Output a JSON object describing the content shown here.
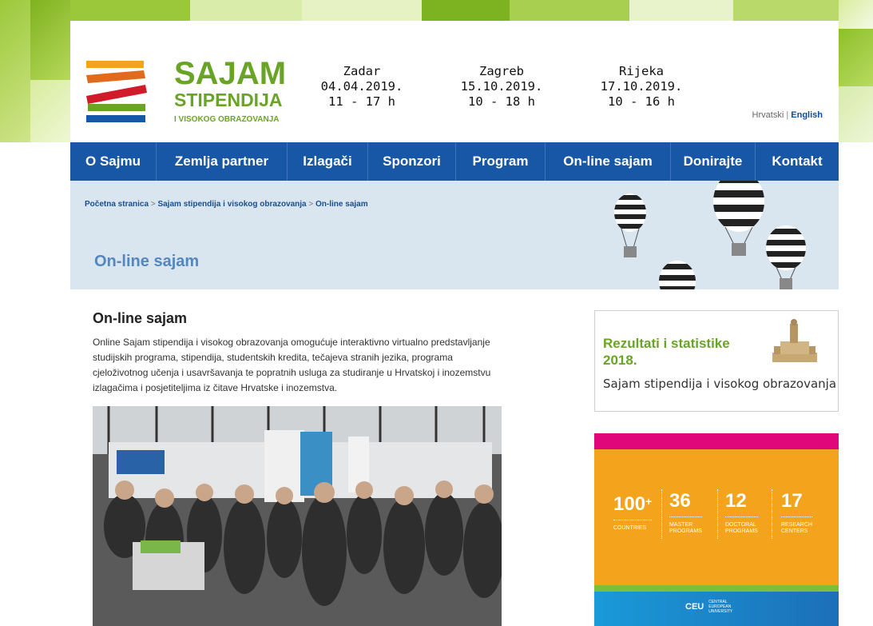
{
  "header": {
    "logo": {
      "title": "SAJAM",
      "subtitle": "STIPENDIJA",
      "tagline": "I VISOKOG OBRAZOVANJA"
    },
    "cities": [
      {
        "name": "Zadar",
        "date": "04.04.2019.",
        "hours": "11 - 17 h"
      },
      {
        "name": "Zagreb",
        "date": "15.10.2019.",
        "hours": "10 - 18 h"
      },
      {
        "name": "Rijeka",
        "date": "17.10.2019.",
        "hours": "10 - 16 h"
      }
    ],
    "languages": {
      "hr": "Hrvatski",
      "sep": "|",
      "en": "English"
    }
  },
  "nav": {
    "items": [
      "O Sajmu",
      "Zemlja partner",
      "Izlagači",
      "Sponzori",
      "Program",
      "On-line sajam",
      "Donirajte",
      "Kontakt"
    ]
  },
  "banner": {
    "breadcrumb": [
      "Početna stranica",
      "Sajam stipendija i visokog obrazovanja",
      "On-line sajam"
    ],
    "breadcrumb_sep": ">",
    "title": "On-line sajam"
  },
  "content": {
    "title": "On-line sajam",
    "text": "Online Sajam stipendija i visokog obrazovanja omogućuje interaktivno virtualno predstavljanje studijskih programa, stipendija, studentskih kredita, tečajeva stranih jezika, programa cjeloživotnog učenja i usavršavanja te popratnih usluga za studiranje u Hrvatskoj i inozemstvu izlagačima i posjetiteljima iz čitave Hrvatske i inozemstva."
  },
  "sidebar": {
    "results": {
      "title_line1": "Rezultati i statistike",
      "title_line2": "2018.",
      "subtitle": "Sajam stipendija i visokog obrazovanja"
    },
    "ceu_ad": {
      "stats": [
        {
          "num": "100",
          "plus": "+",
          "label1": "COUNTRIES",
          "label2": ""
        },
        {
          "num": "36",
          "plus": "",
          "label1": "MASTER",
          "label2": "PROGRAMS"
        },
        {
          "num": "12",
          "plus": "",
          "label1": "DOCTORAL",
          "label2": "PROGRAMS"
        },
        {
          "num": "17",
          "plus": "",
          "label1": "RESEARCH",
          "label2": "CENTERS"
        }
      ],
      "logo_mark": "CEU",
      "logo_name": "CENTRAL EUROPEAN UNIVERSITY"
    }
  },
  "colors": {
    "brand_green": "#6aa426",
    "nav_blue": "#1757a5",
    "banner_bg": "#d9e5ef",
    "ad_orange": "#f3a31c",
    "ad_pink": "#e0077a"
  }
}
